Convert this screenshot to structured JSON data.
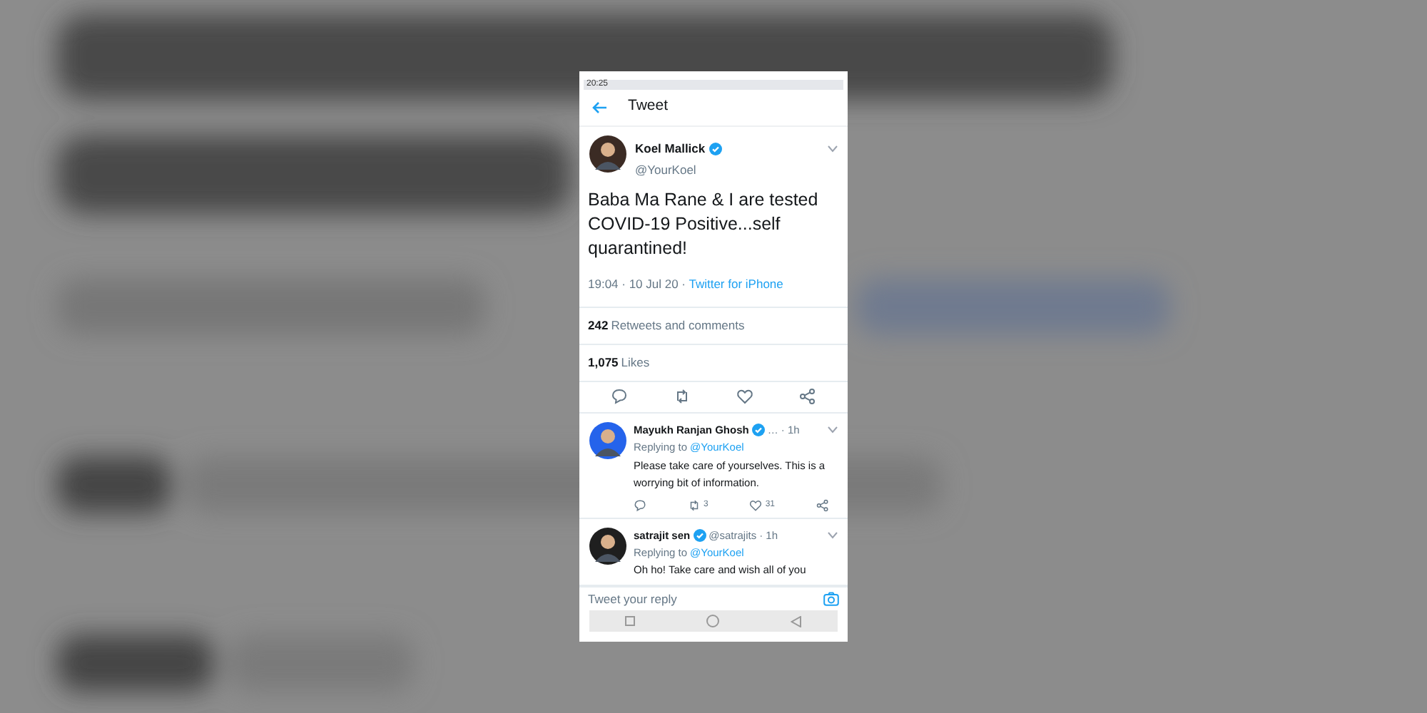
{
  "status_bar": {
    "time": "20:25"
  },
  "header": {
    "title": "Tweet"
  },
  "tweet": {
    "name": "Koel Mallick",
    "verified": true,
    "handle": "@YourKoel",
    "text": "Baba Ma Rane & I are tested COVID-19 Positive...self quarantined!",
    "time": "19:04 · 10 Jul 20 · ",
    "source": "Twitter for iPhone",
    "retweets_count": "242",
    "retweets_label": "Retweets and comments",
    "likes_count": "1,075",
    "likes_label": "Likes"
  },
  "replies": [
    {
      "name": "Mayukh Ranjan Ghosh",
      "verified": true,
      "handle": "…",
      "time": "· 1h",
      "replying_label": "Replying to",
      "replying_to": "@YourKoel",
      "text": "Please take care of yourselves. This is a worrying bit of information.",
      "retweets": "3",
      "likes": "31"
    },
    {
      "name": "satrajit sen",
      "verified": true,
      "handle": "@satrajits",
      "time": "· 1h",
      "replying_label": "Replying to",
      "replying_to": "@YourKoel",
      "text": "Oh ho! Take care and wish all of you"
    }
  ],
  "reply_field": {
    "placeholder": "Tweet your reply"
  }
}
